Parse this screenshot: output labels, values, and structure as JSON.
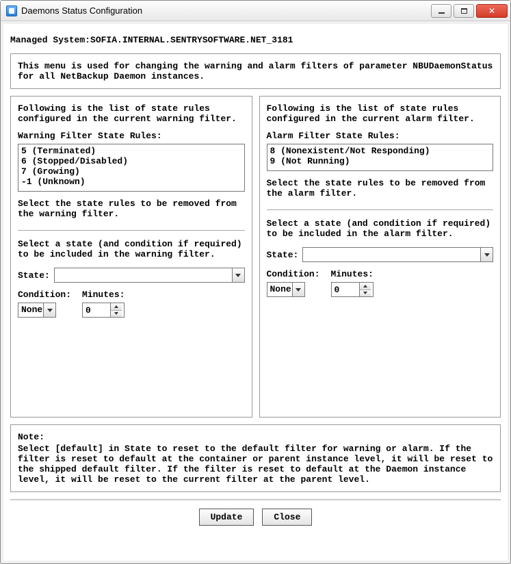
{
  "window": {
    "title": "Daemons Status Configuration"
  },
  "header": {
    "managed_system": "Managed System:SOFIA.INTERNAL.SENTRYSOFTWARE.NET_3181"
  },
  "description": "This menu is used for changing the warning and alarm filters of parameter NBUDaemonStatus for all NetBackup Daemon instances.",
  "warning": {
    "intro": "Following is the list of state rules configured in the current warning filter.",
    "rules_title": "Warning Filter State Rules:",
    "rules": [
      "5 (Terminated)",
      "6 (Stopped/Disabled)",
      "7 (Growing)",
      "-1 (Unknown)"
    ],
    "remove_text": "Select the state rules to be removed from the warning filter.",
    "include_text": "Select a state (and condition if required) to be included in the warning filter.",
    "state_label": "State:",
    "state_value": "",
    "condition_label": "Condition:",
    "condition_value": "None",
    "minutes_label": "Minutes:",
    "minutes_value": "0"
  },
  "alarm": {
    "intro": "Following is the list of state rules configured in the current alarm filter.",
    "rules_title": "Alarm Filter State Rules:",
    "rules": [
      "8 (Nonexistent/Not Responding)",
      "9 (Not Running)"
    ],
    "remove_text": "Select the state rules to be removed from the alarm filter.",
    "include_text": "Select a state (and condition if required) to be included in the alarm filter.",
    "state_label": "State:",
    "state_value": "",
    "condition_label": "Condition:",
    "condition_value": "None",
    "minutes_label": "Minutes:",
    "minutes_value": "0"
  },
  "note": {
    "title": "Note:",
    "body": "Select [default] in State to reset to the default filter for warning or alarm. If the filter is reset to default at the container or parent instance level, it will be reset to the shipped default filter. If the filter is reset to default at the Daemon instance level, it will be reset to the current filter at the parent level."
  },
  "buttons": {
    "update": "Update",
    "close": "Close"
  }
}
